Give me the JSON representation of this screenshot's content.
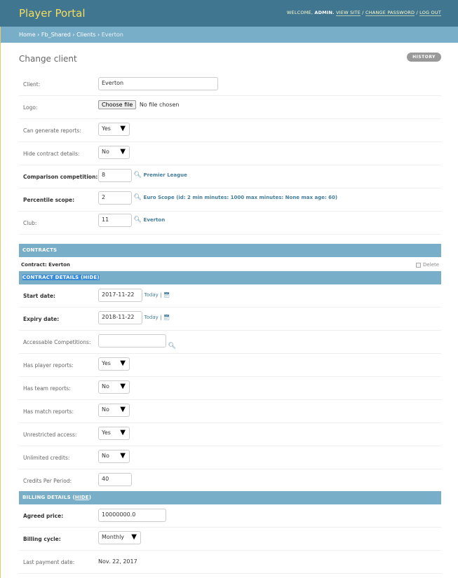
{
  "header": {
    "brand": "Player Portal",
    "welcome": "WELCOME,",
    "user": "ADMIN.",
    "view_site": "VIEW SITE",
    "change_password": "CHANGE PASSWORD",
    "log_out": "LOG OUT",
    "sep": "/"
  },
  "breadcrumbs": {
    "home": "Home",
    "app": "Fb_Shared",
    "model": "Clients",
    "current": "Everton",
    "sep": "›"
  },
  "page": {
    "title": "Change client",
    "history": "HISTORY"
  },
  "client": {
    "client_label": "Client:",
    "client_value": "Everton",
    "logo_label": "Logo:",
    "logo_button": "Choose file",
    "logo_status": "No file chosen",
    "can_generate_label": "Can generate reports:",
    "can_generate_value": "Yes",
    "hide_contract_label": "Hide contract details:",
    "hide_contract_value": "No",
    "comparison_label": "Comparison competition:",
    "comparison_value": "8",
    "comparison_name": "Premier League",
    "percentile_label": "Percentile scope:",
    "percentile_value": "2",
    "percentile_name": "Euro Scope (id: 2 min minutes: 1000 max minutes: None max age: 60)",
    "club_label": "Club:",
    "club_value": "11",
    "club_name": "Everton"
  },
  "contracts": {
    "heading": "CONTRACTS",
    "inline_title": "Contract: Everton",
    "delete_label": "Delete",
    "details_heading": "CONTRACT DETAILS (HIDE)",
    "start_label": "Start date:",
    "start_value": "2017-11-22",
    "expiry_label": "Expiry date:",
    "expiry_value": "2018-11-22",
    "today": "Today",
    "bar": "|",
    "accessible_label": "Accessable Competitions:",
    "accessible_value": "",
    "player_reports_label": "Has player reports:",
    "player_reports_value": "Yes",
    "team_reports_label": "Has team reports:",
    "team_reports_value": "No",
    "match_reports_label": "Has match reports:",
    "match_reports_value": "No",
    "unrestricted_label": "Unrestricted access:",
    "unrestricted_value": "Yes",
    "unlimited_label": "Unlimited credits:",
    "unlimited_value": "No",
    "credits_label": "Credits Per Period:",
    "credits_value": "40"
  },
  "billing": {
    "heading_pre": "BILLING DETAILS (",
    "hide": "HIDE",
    "heading_post": ")",
    "agreed_label": "Agreed price:",
    "agreed_value": "10000000.0",
    "cycle_label": "Billing cycle:",
    "cycle_value": "Monthly",
    "last_payment_label": "Last payment date:",
    "last_payment_value": "Nov. 22, 2017"
  },
  "icons": {
    "lookup": "magnifier-icon",
    "calendar": "calendar-icon",
    "dropdown": "triangle-down-icon"
  },
  "colors": {
    "header_bg": "#417690",
    "breadcrumb_bg": "#79aec8",
    "brand": "#f5dd5d",
    "link": "#447e9b"
  }
}
